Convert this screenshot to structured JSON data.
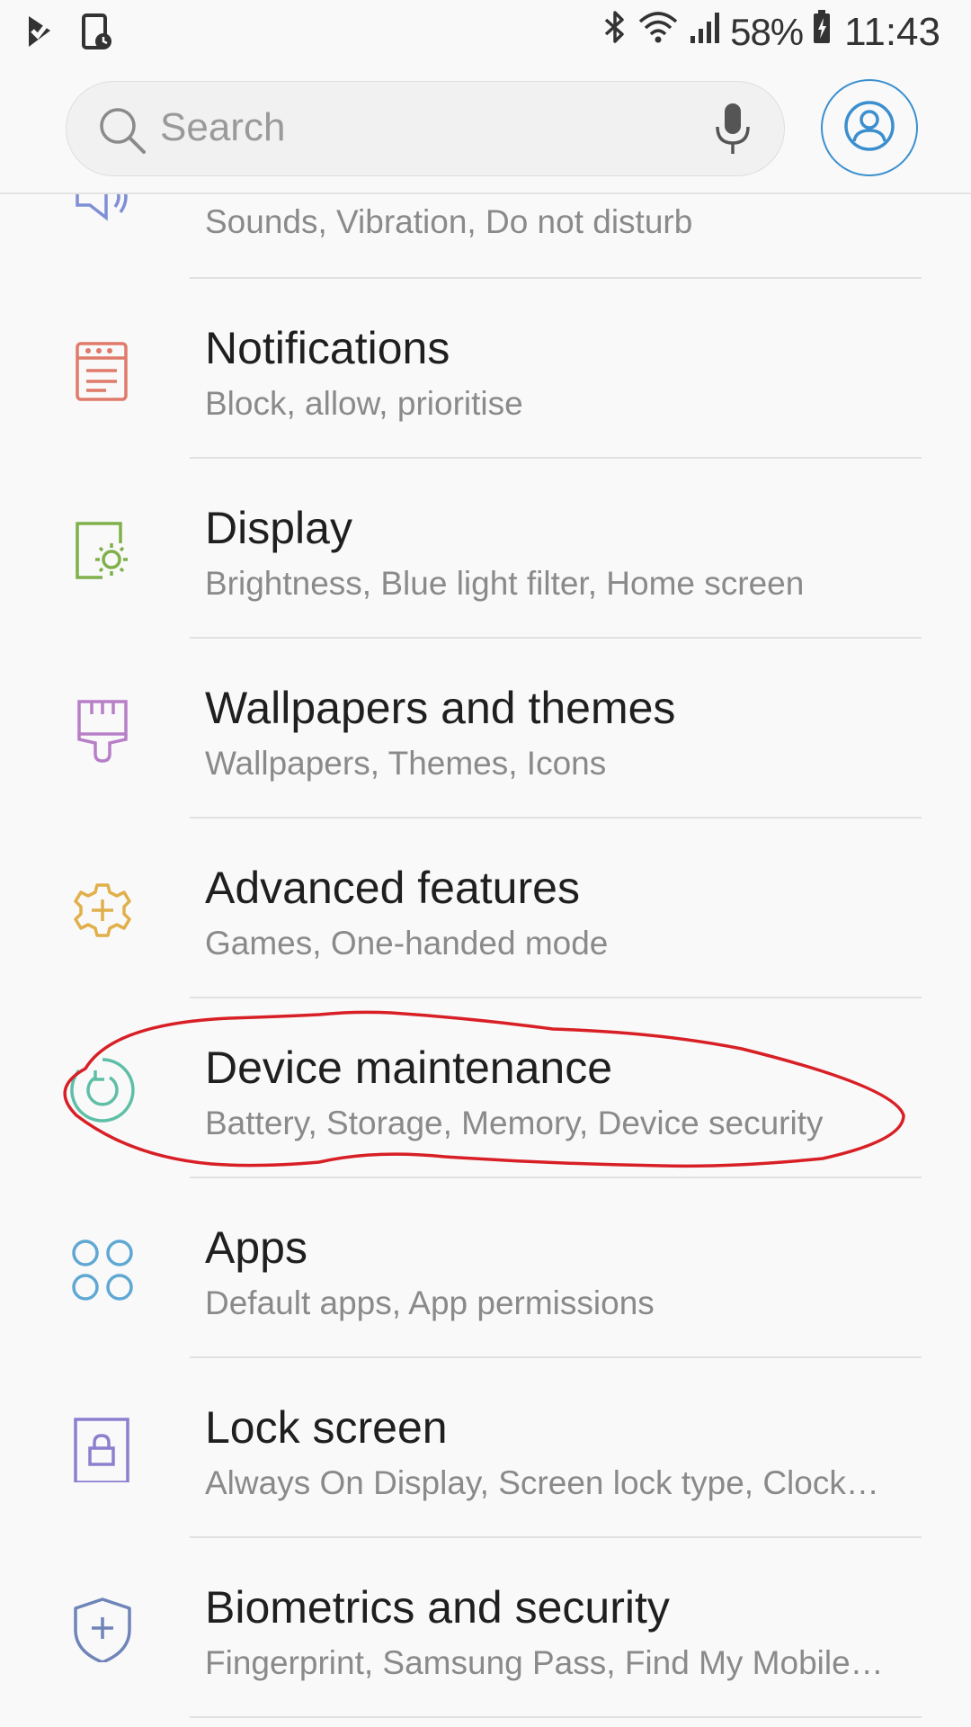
{
  "status_bar": {
    "battery_percent": "58%",
    "time": "11:43",
    "icons": [
      "notification-check-icon",
      "screen-timer-icon",
      "bluetooth-icon",
      "wifi-icon",
      "signal-icon",
      "battery-charging-icon"
    ]
  },
  "search": {
    "placeholder": "Search"
  },
  "settings": {
    "partial_item": {
      "subtitle": "Sounds, Vibration, Do not disturb",
      "icon": "speaker-icon"
    },
    "items": [
      {
        "title": "Notifications",
        "subtitle": "Block, allow, prioritise",
        "icon": "notifications-icon",
        "color": "#e07a6a"
      },
      {
        "title": "Display",
        "subtitle": "Brightness, Blue light filter, Home screen",
        "icon": "display-brightness-icon",
        "color": "#7fb04a"
      },
      {
        "title": "Wallpapers and themes",
        "subtitle": "Wallpapers, Themes, Icons",
        "icon": "paintbrush-icon",
        "color": "#b77fc7"
      },
      {
        "title": "Advanced features",
        "subtitle": "Games, One-handed mode",
        "icon": "gear-plus-icon",
        "color": "#e0b04a"
      },
      {
        "title": "Device maintenance",
        "subtitle": "Battery, Storage, Memory, Device security",
        "icon": "refresh-circle-icon",
        "color": "#5fbfa6"
      },
      {
        "title": "Apps",
        "subtitle": "Default apps, App permissions",
        "icon": "apps-grid-icon",
        "color": "#5fa8d3"
      },
      {
        "title": "Lock screen",
        "subtitle": "Always On Display, Screen lock type, Clock…",
        "icon": "lock-icon",
        "color": "#8c7fd0"
      },
      {
        "title": "Biometrics and security",
        "subtitle": "Fingerprint, Samsung Pass, Find My Mobile…",
        "icon": "shield-icon",
        "color": "#6f84b8"
      }
    ]
  },
  "annotation": {
    "highlight_color": "#d81f26"
  }
}
